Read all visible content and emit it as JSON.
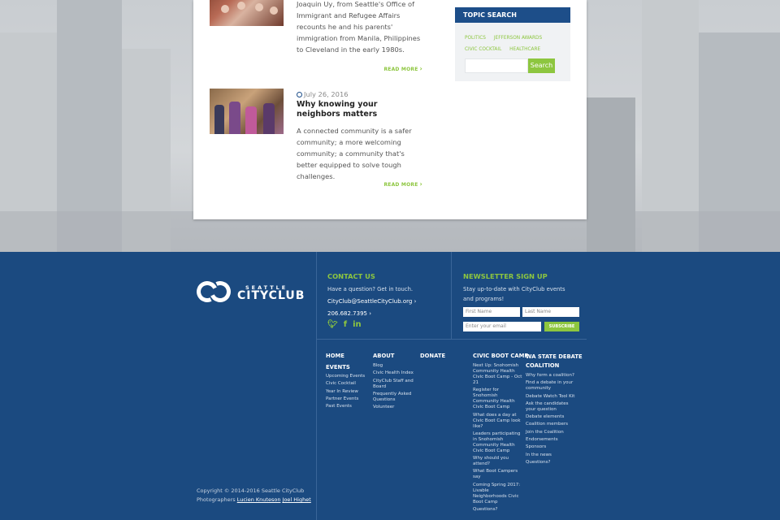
{
  "posts": [
    {
      "excerpt": "Joaquin Uy, from Seattle's Office of Immigrant and Refugee Affairs recounts he and his parents' immigration from Manila, Philippines to Cleveland in the early 1980s.",
      "read_more": "READ MORE"
    },
    {
      "date": "July 26, 2016",
      "title": "Why knowing your neighbors matters",
      "excerpt": "A connected community is a safer community; a more welcoming community; a community that's better equipped to solve tough challenges.",
      "read_more": "READ MORE"
    }
  ],
  "topic_search": {
    "heading": "TOPIC SEARCH",
    "tags": [
      "POLITICS",
      "JEFFERSON AWARDS",
      "CIVIC COCKTAIL",
      "HEALTHCARE"
    ],
    "button": "Search"
  },
  "footer": {
    "logo_top": "SEATTLE",
    "logo_main": "CITYCLUB",
    "contact": {
      "heading": "CONTACT US",
      "subtitle": "Have a question? Get in touch.",
      "email": "CityClub@SeattleCityClub.org",
      "phone": "206.682.7395"
    },
    "newsletter": {
      "heading": "NEWSLETTER SIGN UP",
      "subtitle": "Stay up-to-date with CityClub events and programs!",
      "first_name": "First Name",
      "last_name": "Last Name",
      "email": "Enter your email",
      "button": "SUBSCRIBE"
    },
    "nav": {
      "home": "HOME",
      "events": "EVENTS",
      "events_items": [
        "Upcoming Events",
        "Civic Cocktail",
        "Year In Review",
        "Partner Events",
        "Past Events"
      ],
      "about": "ABOUT",
      "about_items": [
        "Blog",
        "Civic Health Index",
        "CityClub Staff and Board",
        "Frequently Asked Questions",
        "Volunteer"
      ],
      "donate": "DONATE",
      "boot_camp": "CIVIC BOOT CAMP",
      "boot_camp_items": [
        "Next Up: Snohomish Community Health Civic Boot Camp - Oct 21",
        "Register for Snohomish Community Health Civic Boot Camp",
        "What does a day at Civic Boot Camp look like?",
        "Leaders participating in Snohomish Community Health Civic Boot Camp",
        "Why should you attend?",
        "What Boot Campers say",
        "Coming Spring 2017: Livable Neighborhoods Civic Boot Camp",
        "Questions?"
      ],
      "debate": "WA STATE DEBATE COALITION",
      "debate_items": [
        "Why form a coalition?",
        "Find a debate in your community",
        "Debate Watch Tool Kit",
        "Ask the candidates your question",
        "Debate elements",
        "Coalition members",
        "Join the Coalition",
        "Endorsements",
        "Sponsors",
        "In the news",
        "Questions?"
      ]
    },
    "copyright": "Copyright © 2014-2016 Seattle CityClub",
    "photographers_label": "Photographers",
    "photographer1": "Lucien Knuteson",
    "photographer2": "Joel Highet"
  }
}
